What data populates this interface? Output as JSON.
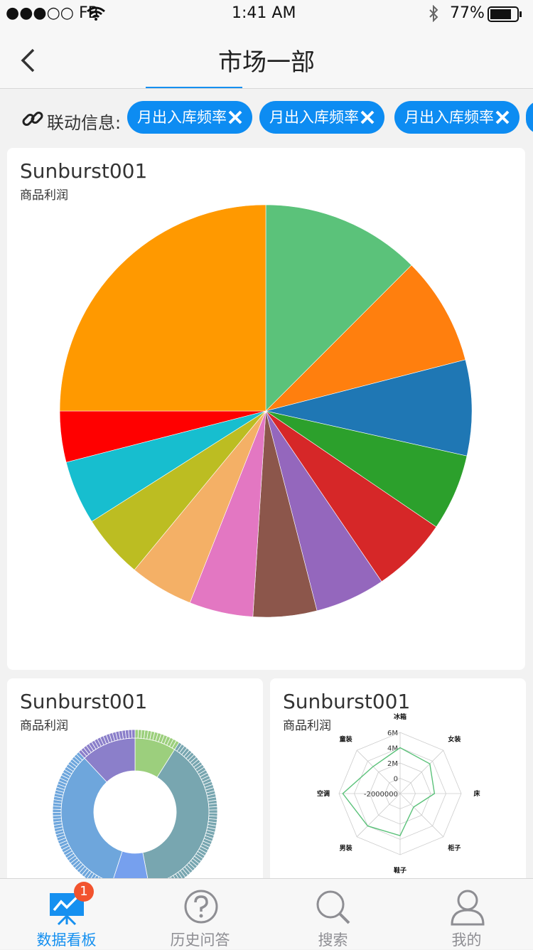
{
  "status_bar": {
    "carrier": "●●●○○ FB",
    "time": "1:41 AM",
    "battery": "77%"
  },
  "nav": {
    "title": "市场一部"
  },
  "link_info": {
    "label": "联动信息:",
    "chips": [
      "月出入库频率",
      "月出入库频率",
      "月出入库频率"
    ]
  },
  "chart_data": [
    {
      "type": "pie",
      "title": "Sunburst001",
      "subtitle": "商品利润",
      "slices": [
        {
          "value": 12.5,
          "color": "#5bc27a"
        },
        {
          "value": 8.5,
          "color": "#ff7f0e"
        },
        {
          "value": 7.5,
          "color": "#1f77b4"
        },
        {
          "value": 6.0,
          "color": "#2ca02c"
        },
        {
          "value": 6.0,
          "color": "#d62728"
        },
        {
          "value": 5.5,
          "color": "#9467bd"
        },
        {
          "value": 5.0,
          "color": "#8c564b"
        },
        {
          "value": 5.0,
          "color": "#e377c2"
        },
        {
          "value": 5.0,
          "color": "#f4b066"
        },
        {
          "value": 5.0,
          "color": "#bcbd22"
        },
        {
          "value": 5.0,
          "color": "#17becf"
        },
        {
          "value": 4.0,
          "color": "#ff0000"
        },
        {
          "value": 25.0,
          "color": "#ff9900"
        }
      ]
    },
    {
      "type": "sunburst",
      "title": "Sunburst001",
      "subtitle": "商品利润",
      "segments": [
        {
          "value": 9,
          "color": "#9ccf7d"
        },
        {
          "value": 38,
          "color": "#78a6b0"
        },
        {
          "value": 8,
          "color": "#76a0ee"
        },
        {
          "value": 33,
          "color": "#6ea6dc"
        },
        {
          "value": 12,
          "color": "#8b7fca"
        }
      ]
    },
    {
      "type": "radar",
      "title": "Sunburst001",
      "subtitle": "商品利润",
      "indicators": [
        "冰箱",
        "女装",
        "床",
        "柜子",
        "鞋子",
        "男装",
        "空调",
        "童装"
      ],
      "tick_labels": [
        "6M",
        "4M",
        "2M",
        "0",
        "-2000000"
      ],
      "range": [
        -2000000,
        6000000
      ],
      "series": [
        {
          "values": [
            4000000,
            3500000,
            2500000,
            500000,
            3500000,
            4000000,
            5500000,
            3000000
          ],
          "color": "#5bc27a"
        }
      ]
    }
  ],
  "tabbar": {
    "badge": "1",
    "items": [
      {
        "label": "数据看板",
        "icon": "dashboard-icon"
      },
      {
        "label": "历史问答",
        "icon": "question-icon"
      },
      {
        "label": "搜索",
        "icon": "search-icon"
      },
      {
        "label": "我的",
        "icon": "user-icon"
      }
    ]
  },
  "colors": {
    "accent": "#1690f0",
    "chip": "#0d8cf2",
    "badge": "#f2532e"
  }
}
